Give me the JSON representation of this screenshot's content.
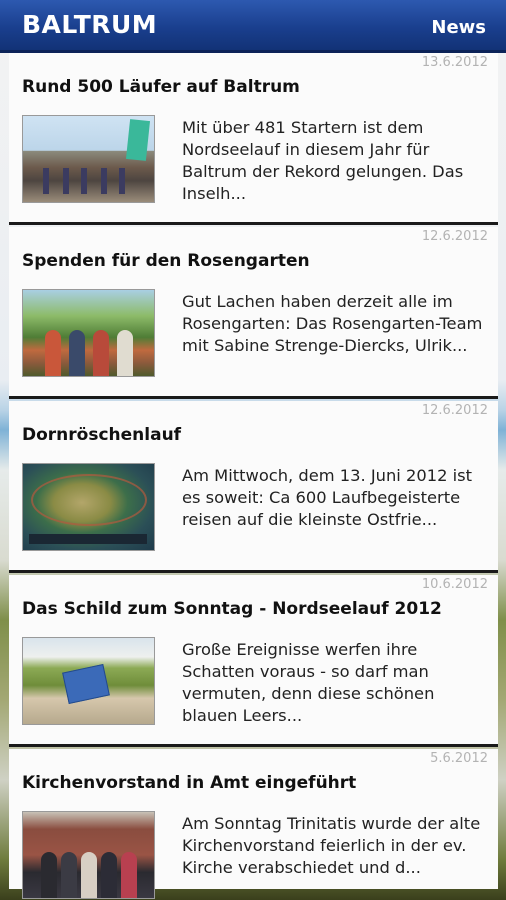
{
  "appbar": {
    "title": "BALTRUM",
    "section": "News"
  },
  "news": [
    {
      "date": "13.6.2012",
      "title": "Rund 500 Läufer auf Baltrum",
      "excerpt": "Mit über 481 Startern ist dem Nordseelauf in diesem Jahr für Baltrum der Rekord gelungen. Das Inselh..."
    },
    {
      "date": "12.6.2012",
      "title": "Spenden für den Rosengarten",
      "excerpt": "Gut Lachen haben derzeit alle im Rosengarten: Das Rosengarten-Team mit Sabine Strenge-Diercks, Ulrik..."
    },
    {
      "date": "12.6.2012",
      "title": "Dornröschenlauf",
      "excerpt": "Am Mittwoch, dem 13. Juni 2012 ist es soweit: Ca 600 Laufbegeisterte reisen auf die kleinste Ostfrie..."
    },
    {
      "date": "10.6.2012",
      "title": "Das Schild zum Sonntag - Nordseelauf 2012",
      "excerpt": "Große Ereignisse werfen ihre Schatten voraus - so darf man vermuten, denn diese schönen blauen Leers..."
    },
    {
      "date": "5.6.2012",
      "title": "Kirchenvorstand in Amt eingeführt",
      "excerpt": "Am Sonntag Trinitatis wurde der alte Kirchenvorstand feierlich in der ev. Kirche verabschiedet und d..."
    }
  ]
}
